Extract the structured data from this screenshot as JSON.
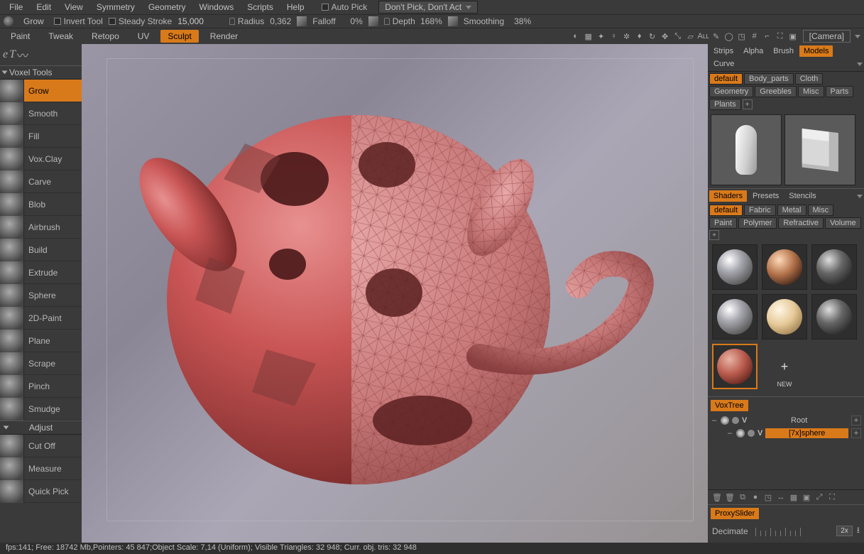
{
  "menubar": {
    "items": [
      "File",
      "Edit",
      "View",
      "Symmetry",
      "Geometry",
      "Windows",
      "Scripts",
      "Help"
    ],
    "auto_pick": "Auto Pick",
    "dropdown": "Don't Pick, Don't Act"
  },
  "toolbar": {
    "grow": "Grow",
    "invert": "Invert Tool",
    "steady": "Steady Stroke",
    "steady_val": "15,000",
    "radius": "Radius",
    "radius_val": "0,362",
    "falloff": "Falloff",
    "falloff_val": "0%",
    "depth": "Depth",
    "depth_val": "168%",
    "smoothing": "Smoothing",
    "smoothing_val": "38%"
  },
  "workspace": {
    "tabs": [
      "Paint",
      "Tweak",
      "Retopo",
      "UV",
      "Sculpt",
      "Render"
    ],
    "active": "Sculpt",
    "camera": "[Camera]"
  },
  "voxel_tools": {
    "header": "Voxel Tools",
    "tools": [
      "Grow",
      "Smooth",
      "Fill",
      "Vox.Clay",
      "Carve",
      "Blob",
      "Airbrush",
      "Build",
      "Extrude",
      "Sphere",
      "2D-Paint",
      "Plane",
      "Scrape",
      "Pinch",
      "Smudge"
    ],
    "active": "Grow",
    "adjust_header": "Adjust",
    "adjust": [
      "Cut Off",
      "Measure",
      "Quick Pick"
    ]
  },
  "right": {
    "top_tabs": [
      "Strips",
      "Alpha",
      "Brush",
      "Models",
      "Curve"
    ],
    "top_active": "Models",
    "model_cats": [
      "default",
      "Body_parts",
      "Cloth",
      "Geometry",
      "Greebles",
      "Misc",
      "Parts",
      "Plants"
    ],
    "model_cat_active": "default",
    "shader_tabs": [
      "Shaders",
      "Presets",
      "Stencils"
    ],
    "shader_tab_active": "Shaders",
    "shader_cats": [
      "default",
      "Fabric",
      "Metal",
      "Misc",
      "Paint",
      "Polymer",
      "Refractive",
      "Volume"
    ],
    "shader_cat_active": "default",
    "new_label": "NEW",
    "voxtree_header": "VoxTree",
    "tree": {
      "root": "Root",
      "child": "[7x]sphere"
    },
    "proxy_header": "ProxySlider",
    "decimate": "Decimate",
    "decimate_val": "2x"
  },
  "status": {
    "text": "fps:141;    Free: 18742 Mb,Pointers: 45 847;Object Scale: 7,14 (Uniform); Visible Triangles: 32 948; Curr. obj. tris: 32 948"
  }
}
